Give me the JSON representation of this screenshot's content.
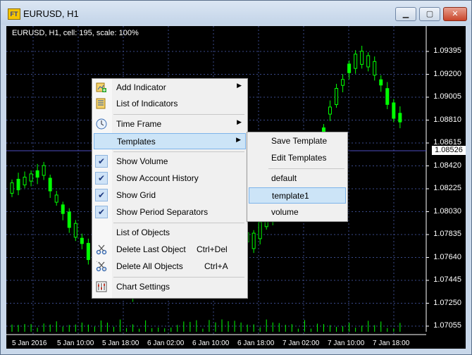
{
  "window": {
    "title": "EURUSD, H1",
    "buttons": {
      "minimize": "▁",
      "maximize": "▢",
      "close": "✕"
    }
  },
  "chart": {
    "header": "EURUSD, H1, cell: 195, scale: 100%",
    "current_price": "1.08526",
    "price_labels": [
      "1.09395",
      "1.09200",
      "1.09005",
      "1.08810",
      "1.08615",
      "1.08420",
      "1.08225",
      "1.08030",
      "1.07835",
      "1.07640",
      "1.07445",
      "1.07250",
      "1.07055"
    ],
    "time_labels": [
      "5 Jan 2016",
      "5 Jan 10:00",
      "5 Jan 18:00",
      "6 Jan 02:00",
      "6 Jan 10:00",
      "6 Jan 18:00",
      "7 Jan 02:00",
      "7 Jan 10:00",
      "7 Jan 18:00"
    ],
    "colors": {
      "background": "#000000",
      "candles": "#00ff00",
      "grid": "#3a4a8a",
      "price_line": "#4c4cc0"
    }
  },
  "context_menu": {
    "items": [
      {
        "label": "Add Indicator",
        "icon": "add-indicator-icon",
        "submenu": true
      },
      {
        "label": "List of Indicators",
        "icon": "list-indicators-icon"
      },
      {
        "label": "Time Frame",
        "icon": "clock-icon",
        "submenu": true
      },
      {
        "label": "Templates",
        "submenu": true,
        "highlighted": true
      },
      {
        "label": "Show Volume",
        "checked": true
      },
      {
        "label": "Show Account History",
        "checked": true
      },
      {
        "label": "Show Grid",
        "checked": true
      },
      {
        "label": "Show Period Separators",
        "checked": true
      },
      {
        "label": "List of Objects"
      },
      {
        "label": "Delete Last Object",
        "icon": "scissors-icon",
        "shortcut": "Ctrl+Del"
      },
      {
        "label": "Delete All Objects",
        "icon": "scissors-all-icon",
        "shortcut": "Ctrl+A"
      },
      {
        "label": "Chart Settings",
        "icon": "settings-icon"
      }
    ]
  },
  "templates_submenu": {
    "items": [
      {
        "label": "Save Template"
      },
      {
        "label": "Edit Templates"
      },
      {
        "label": "default"
      },
      {
        "label": "template1",
        "highlighted": true
      },
      {
        "label": "volume"
      }
    ]
  }
}
